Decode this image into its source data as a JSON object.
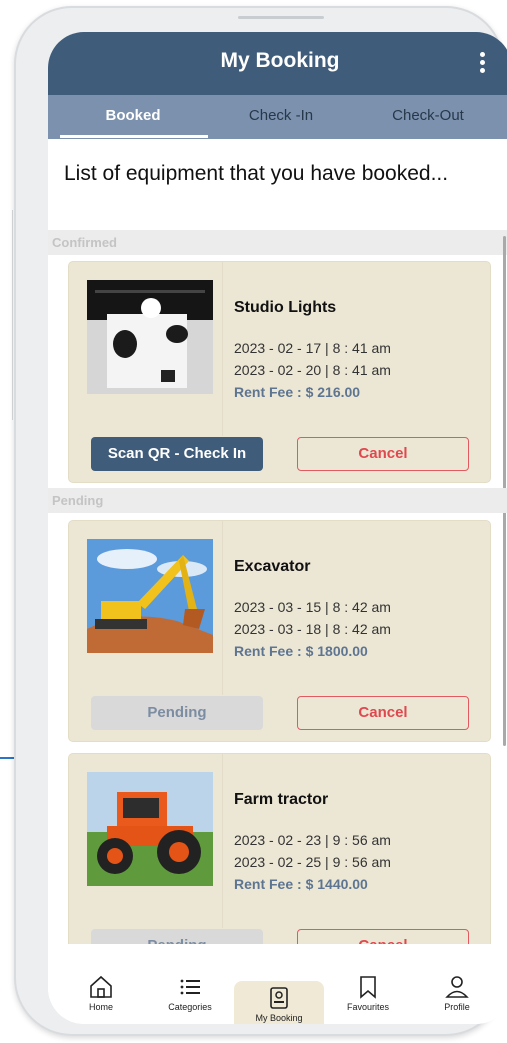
{
  "header": {
    "title": "My Booking",
    "menu_icon": "kebab-menu-icon"
  },
  "tabs": [
    {
      "label": "Booked",
      "active": true
    },
    {
      "label": "Check -In",
      "active": false
    },
    {
      "label": "Check-Out",
      "active": false
    }
  ],
  "intro_text": "List of equipment that you have booked...",
  "sections": {
    "confirmed": "Confirmed",
    "pending": "Pending"
  },
  "bookings": [
    {
      "name": "Studio Lights",
      "start": "2023 - 02 - 17 | 8 : 41 am",
      "end": "2023 - 02 - 20 | 8 : 41 am",
      "fee": "Rent Fee : $ 216.00",
      "primary_action": "Scan QR - Check In",
      "cancel": "Cancel",
      "status": "confirmed"
    },
    {
      "name": "Excavator",
      "start": "2023 - 03 - 15 | 8 : 42 am",
      "end": "2023 - 03 - 18 | 8 : 42 am",
      "fee": "Rent Fee : $ 1800.00",
      "primary_action": "Pending",
      "cancel": "Cancel",
      "status": "pending"
    },
    {
      "name": "Farm tractor",
      "start": "2023 - 02 - 23 | 9 : 56 am",
      "end": "2023 - 02 - 25 | 9 : 56 am",
      "fee": "Rent Fee : $ 1440.00",
      "primary_action": "Pending",
      "cancel": "Cancel",
      "status": "pending"
    }
  ],
  "bottom_nav": [
    {
      "label": "Home",
      "icon": "home-icon",
      "active": false
    },
    {
      "label": "Categories",
      "icon": "list-icon",
      "active": false
    },
    {
      "label": "My Booking",
      "icon": "booking-icon",
      "active": true
    },
    {
      "label": "Favourites",
      "icon": "bookmark-icon",
      "active": false
    },
    {
      "label": "Profile",
      "icon": "profile-icon",
      "active": false
    }
  ],
  "colors": {
    "header": "#3f5c7a",
    "tabs": "#7b91ad",
    "card": "#ece7d5",
    "cancel": "#e05a60",
    "fee": "#5e7592"
  }
}
